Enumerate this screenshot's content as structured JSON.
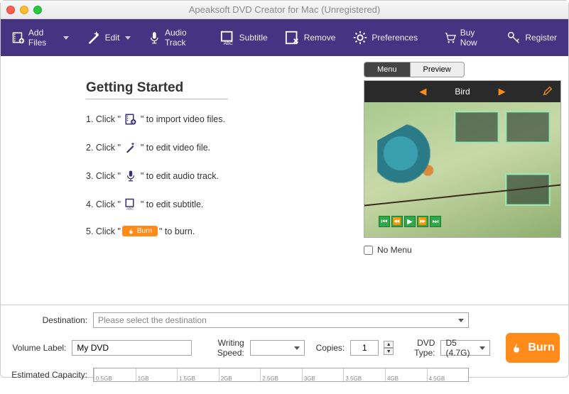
{
  "window": {
    "title": "Apeaksoft DVD Creator for Mac (Unregistered)"
  },
  "toolbar": {
    "add_files": "Add Files",
    "edit": "Edit",
    "audio_track": "Audio Track",
    "subtitle": "Subtitle",
    "remove": "Remove",
    "preferences": "Preferences",
    "buy_now": "Buy Now",
    "register": "Register"
  },
  "getting_started": {
    "heading": "Getting Started",
    "steps": {
      "s1a": "1. Click \"",
      "s1b": "\" to import video files.",
      "s2a": "2. Click \"",
      "s2b": "\" to edit video file.",
      "s3a": "3. Click \"",
      "s3b": "\" to edit audio track.",
      "s4a": "4. Click \"",
      "s4b": "\" to edit subtitle.",
      "s5a": "5. Click \"",
      "s5b": "\" to burn.",
      "burn_mini": "Burn"
    }
  },
  "preview": {
    "tab_menu": "Menu",
    "tab_preview": "Preview",
    "menu_title": "Bird",
    "no_menu": "No Menu"
  },
  "form": {
    "destination_label": "Destination:",
    "destination_placeholder": "Please select the destination",
    "volume_label_label": "Volume Label:",
    "volume_label_value": "My DVD",
    "writing_speed_label": "Writing Speed:",
    "writing_speed_value": "",
    "copies_label": "Copies:",
    "copies_value": "1",
    "dvd_type_label": "DVD Type:",
    "dvd_type_value": "D5 (4.7G)",
    "capacity_label": "Estimated Capacity:",
    "ticks": [
      "0.5GB",
      "1GB",
      "1.5GB",
      "2GB",
      "2.5GB",
      "3GB",
      "3.5GB",
      "4GB",
      "4.5GB"
    ],
    "burn": "Burn"
  }
}
